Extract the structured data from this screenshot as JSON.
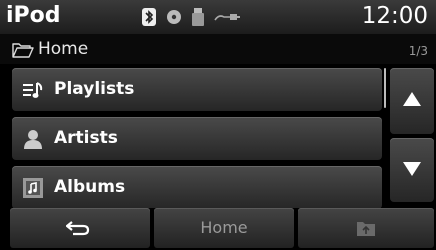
{
  "app": {
    "title": "iPod",
    "clock": "12:00"
  },
  "status": {
    "icons": [
      "bluetooth-icon",
      "disc-icon",
      "usb-icon",
      "aux-cable-icon"
    ]
  },
  "path": {
    "label": "Home",
    "page": "1/3"
  },
  "list": {
    "items": [
      {
        "label": "Playlists",
        "icon": "playlist-icon"
      },
      {
        "label": "Artists",
        "icon": "artist-icon"
      },
      {
        "label": "Albums",
        "icon": "album-icon"
      }
    ]
  },
  "bottom": {
    "back_icon": "back-arrow-icon",
    "home_label": "Home",
    "folder_icon": "folder-up-icon"
  },
  "colors": {
    "background": "#000000",
    "button": "#333333",
    "text": "#ffffff",
    "muted": "#9a9a9a"
  }
}
